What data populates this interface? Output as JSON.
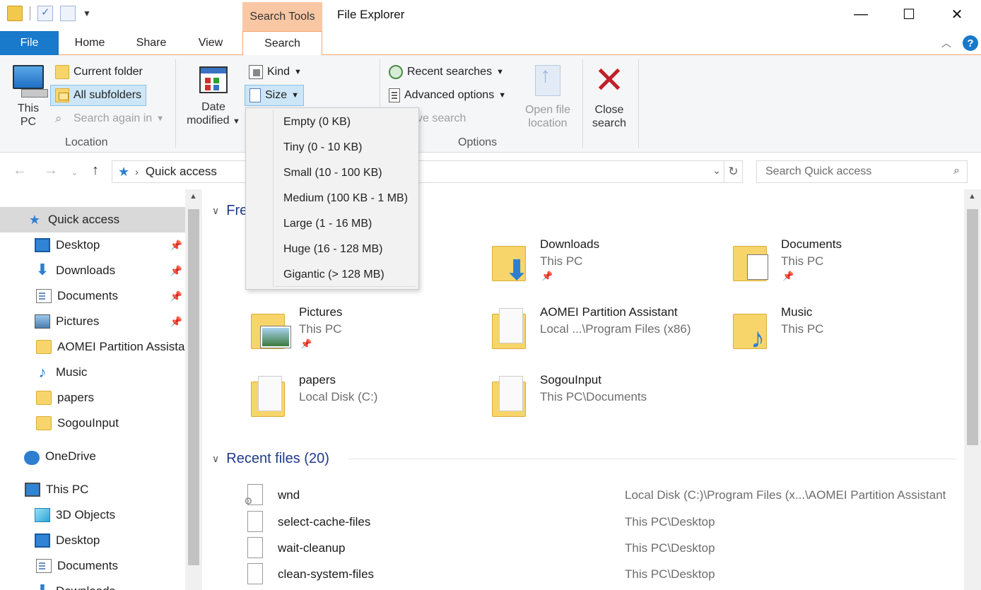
{
  "window": {
    "title": "File Explorer",
    "context_tab": "Search Tools",
    "minimize": "—",
    "maximize": "☐",
    "close": "✕"
  },
  "tabs": [
    "File",
    "Home",
    "Share",
    "View",
    "Search"
  ],
  "ribbon": {
    "location": {
      "group_label": "Location",
      "this_pc_line1": "This",
      "this_pc_line2": "PC",
      "current_folder": "Current folder",
      "all_subfolders": "All subfolders",
      "search_again_in": "Search again in"
    },
    "refine": {
      "date_modified_line1": "Date",
      "date_modified_line2": "modified",
      "kind": "Kind",
      "size": "Size"
    },
    "options": {
      "group_label": "Options",
      "recent_searches": "Recent searches",
      "advanced_options": "Advanced options",
      "save_search_partial": "ve search",
      "open_file_location_line1": "Open file",
      "open_file_location_line2": "location",
      "close_search_line1": "Close",
      "close_search_line2": "search"
    }
  },
  "size_menu": [
    "Empty (0 KB)",
    "Tiny (0 - 10 KB)",
    "Small (10 - 100 KB)",
    "Medium (100 KB - 1 MB)",
    "Large (1 - 16 MB)",
    "Huge (16 - 128 MB)",
    "Gigantic (> 128 MB)"
  ],
  "address": {
    "path": "Quick access",
    "search_placeholder": "Search Quick access"
  },
  "nav": {
    "quick_access": "Quick access",
    "items": [
      {
        "label": "Desktop",
        "pinned": true
      },
      {
        "label": "Downloads",
        "pinned": true
      },
      {
        "label": "Documents",
        "pinned": true
      },
      {
        "label": "Pictures",
        "pinned": true
      },
      {
        "label": "AOMEI Partition Assista",
        "pinned": false
      },
      {
        "label": "Music",
        "pinned": false
      },
      {
        "label": "papers",
        "pinned": false
      },
      {
        "label": "SogouInput",
        "pinned": false
      }
    ],
    "onedrive": "OneDrive",
    "this_pc": "This PC",
    "pc_items": [
      "3D Objects",
      "Desktop",
      "Documents",
      "Downloads"
    ]
  },
  "content": {
    "frequent_header_partial": "Fre",
    "frequent": [
      {
        "name": "Downloads",
        "location": "This PC",
        "pinned": true
      },
      {
        "name": "Documents",
        "location": "This PC",
        "pinned": true
      },
      {
        "name": "Pictures",
        "location": "This PC",
        "pinned": true
      },
      {
        "name": "AOMEI Partition Assistant",
        "location": "Local ...\\Program Files (x86)",
        "pinned": false
      },
      {
        "name": "Music",
        "location": "This PC",
        "pinned": false
      },
      {
        "name": "papers",
        "location": "Local Disk (C:)",
        "pinned": false
      },
      {
        "name": "SogouInput",
        "location": "This PC\\Documents",
        "pinned": false
      }
    ],
    "recent_header": "Recent files (20)",
    "recent": [
      {
        "name": "wnd",
        "location": "Local Disk (C:)\\Program Files (x...\\AOMEI Partition Assistant"
      },
      {
        "name": "select-cache-files",
        "location": "This PC\\Desktop"
      },
      {
        "name": "wait-cleanup",
        "location": "This PC\\Desktop"
      },
      {
        "name": "clean-system-files",
        "location": "This PC\\Desktop"
      }
    ]
  }
}
